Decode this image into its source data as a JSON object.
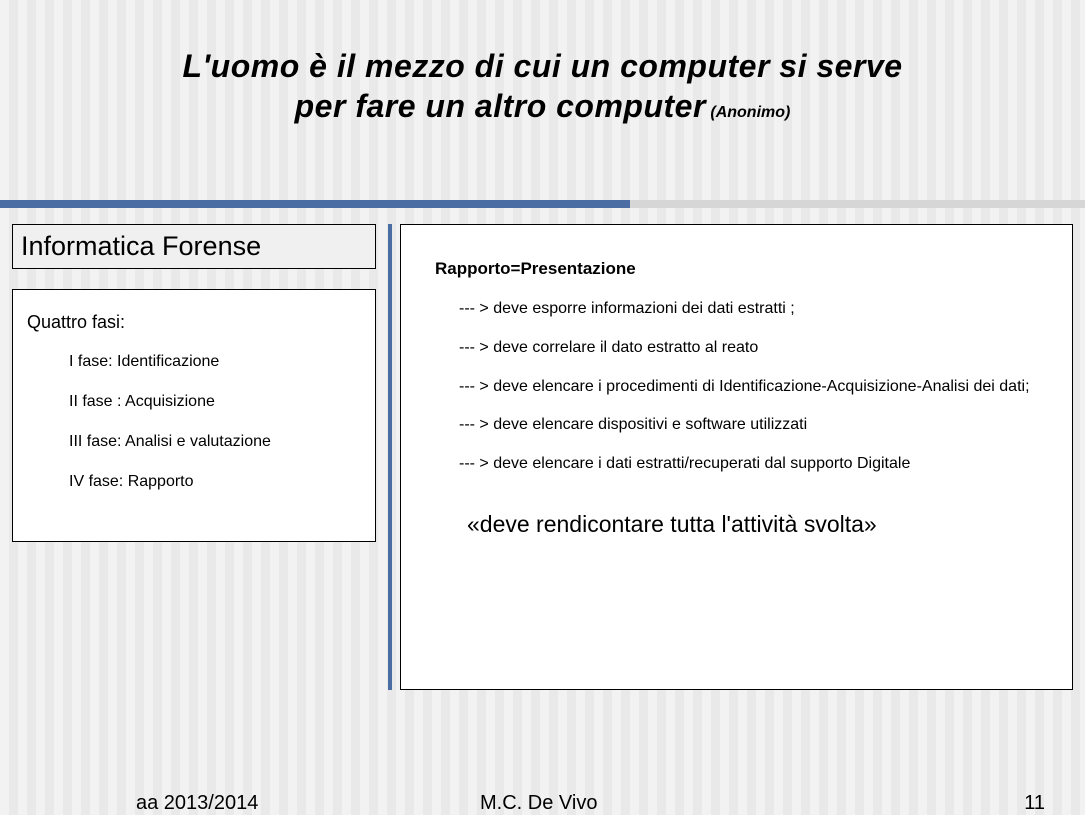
{
  "title": {
    "line1": "L'uomo è il mezzo di cui un computer si serve",
    "line2": "per fare  un altro computer",
    "author": "(Anonimo)"
  },
  "leftBox": {
    "header": "Informatica Forense",
    "phasesTitle": "Quattro fasi:",
    "phases": [
      "I fase: Identificazione",
      "II fase : Acquisizione",
      "III fase: Analisi e valutazione",
      "IV fase: Rapporto"
    ]
  },
  "rightBox": {
    "heading": "Rapporto=Presentazione",
    "items": [
      "--- >  deve esporre informazioni dei dati estratti ;",
      "--- > deve correlare il dato estratto al reato",
      "--- > deve elencare i procedimenti di Identificazione-Acquisizione-Analisi dei dati;",
      "--- > deve elencare dispositivi e software utilizzati",
      "--- > deve elencare i dati estratti/recuperati dal supporto Digitale"
    ],
    "quote": "«deve rendicontare tutta l'attività svolta»"
  },
  "footer": {
    "year": "aa 2013/2014",
    "author": "M.C. De Vivo",
    "page": "11"
  }
}
